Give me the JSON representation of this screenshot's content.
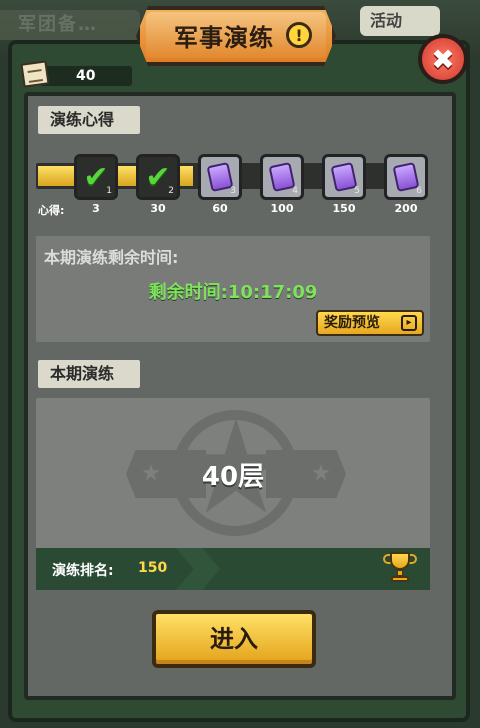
{
  "background": {
    "left_tab": "军团备…",
    "right_tab": "活动"
  },
  "header": {
    "title": "军事演练",
    "alert_badge": "!"
  },
  "close_button": {
    "label": "✖"
  },
  "currency": {
    "icon": "paper-scroll-icon",
    "value": "40"
  },
  "insight_section": {
    "tag": "演练心得",
    "points_label": "心得:",
    "progress_fraction": 0.4,
    "nodes": [
      {
        "index": "1",
        "threshold": "3",
        "state": "claimed"
      },
      {
        "index": "2",
        "threshold": "30",
        "state": "claimed"
      },
      {
        "index": "3",
        "threshold": "60",
        "state": "locked"
      },
      {
        "index": "4",
        "threshold": "100",
        "state": "locked"
      },
      {
        "index": "5",
        "threshold": "150",
        "state": "locked"
      },
      {
        "index": "6",
        "threshold": "200",
        "state": "locked"
      }
    ]
  },
  "timer_section": {
    "title": "本期演练剩余时间:",
    "remaining": "剩余时间:10:17:09",
    "reward_preview": "奖励预览"
  },
  "current_drill": {
    "tag": "本期演练",
    "floor": "40层",
    "rank_label": "演练排名:",
    "rank_value": "150"
  },
  "enter_button": {
    "label": "进入"
  },
  "colors": {
    "accent_gold": "#e6a820",
    "panel_gray": "#646865",
    "frame_green": "#2f4a33",
    "check_green": "#58d43c",
    "timer_green": "#7fe15d"
  }
}
